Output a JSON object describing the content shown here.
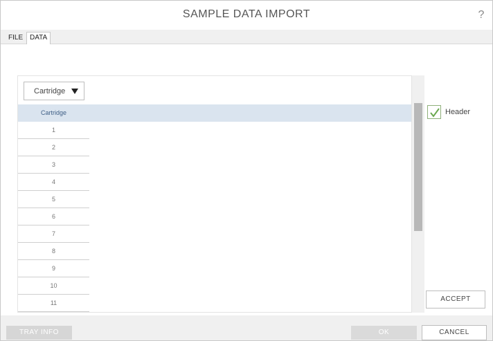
{
  "window": {
    "title": "SAMPLE DATA IMPORT",
    "help_label": "?"
  },
  "tabs": [
    {
      "label": "FILE"
    },
    {
      "label": "DATA"
    }
  ],
  "column_select": {
    "selected": "Cartridge"
  },
  "grid": {
    "header": "Cartridge",
    "rows": [
      "1",
      "2",
      "3",
      "4",
      "5",
      "6",
      "7",
      "8",
      "9",
      "10",
      "11"
    ]
  },
  "header_option": {
    "label": "Header",
    "checked": true
  },
  "buttons": {
    "accept": "ACCEPT",
    "tray_info": "TRAY INFO",
    "ok": "OK",
    "cancel": "CANCEL"
  },
  "colors": {
    "header_row_bg": "#dae4ef",
    "check_color": "#6aa84f",
    "disabled_button": "#d6d6d6"
  }
}
